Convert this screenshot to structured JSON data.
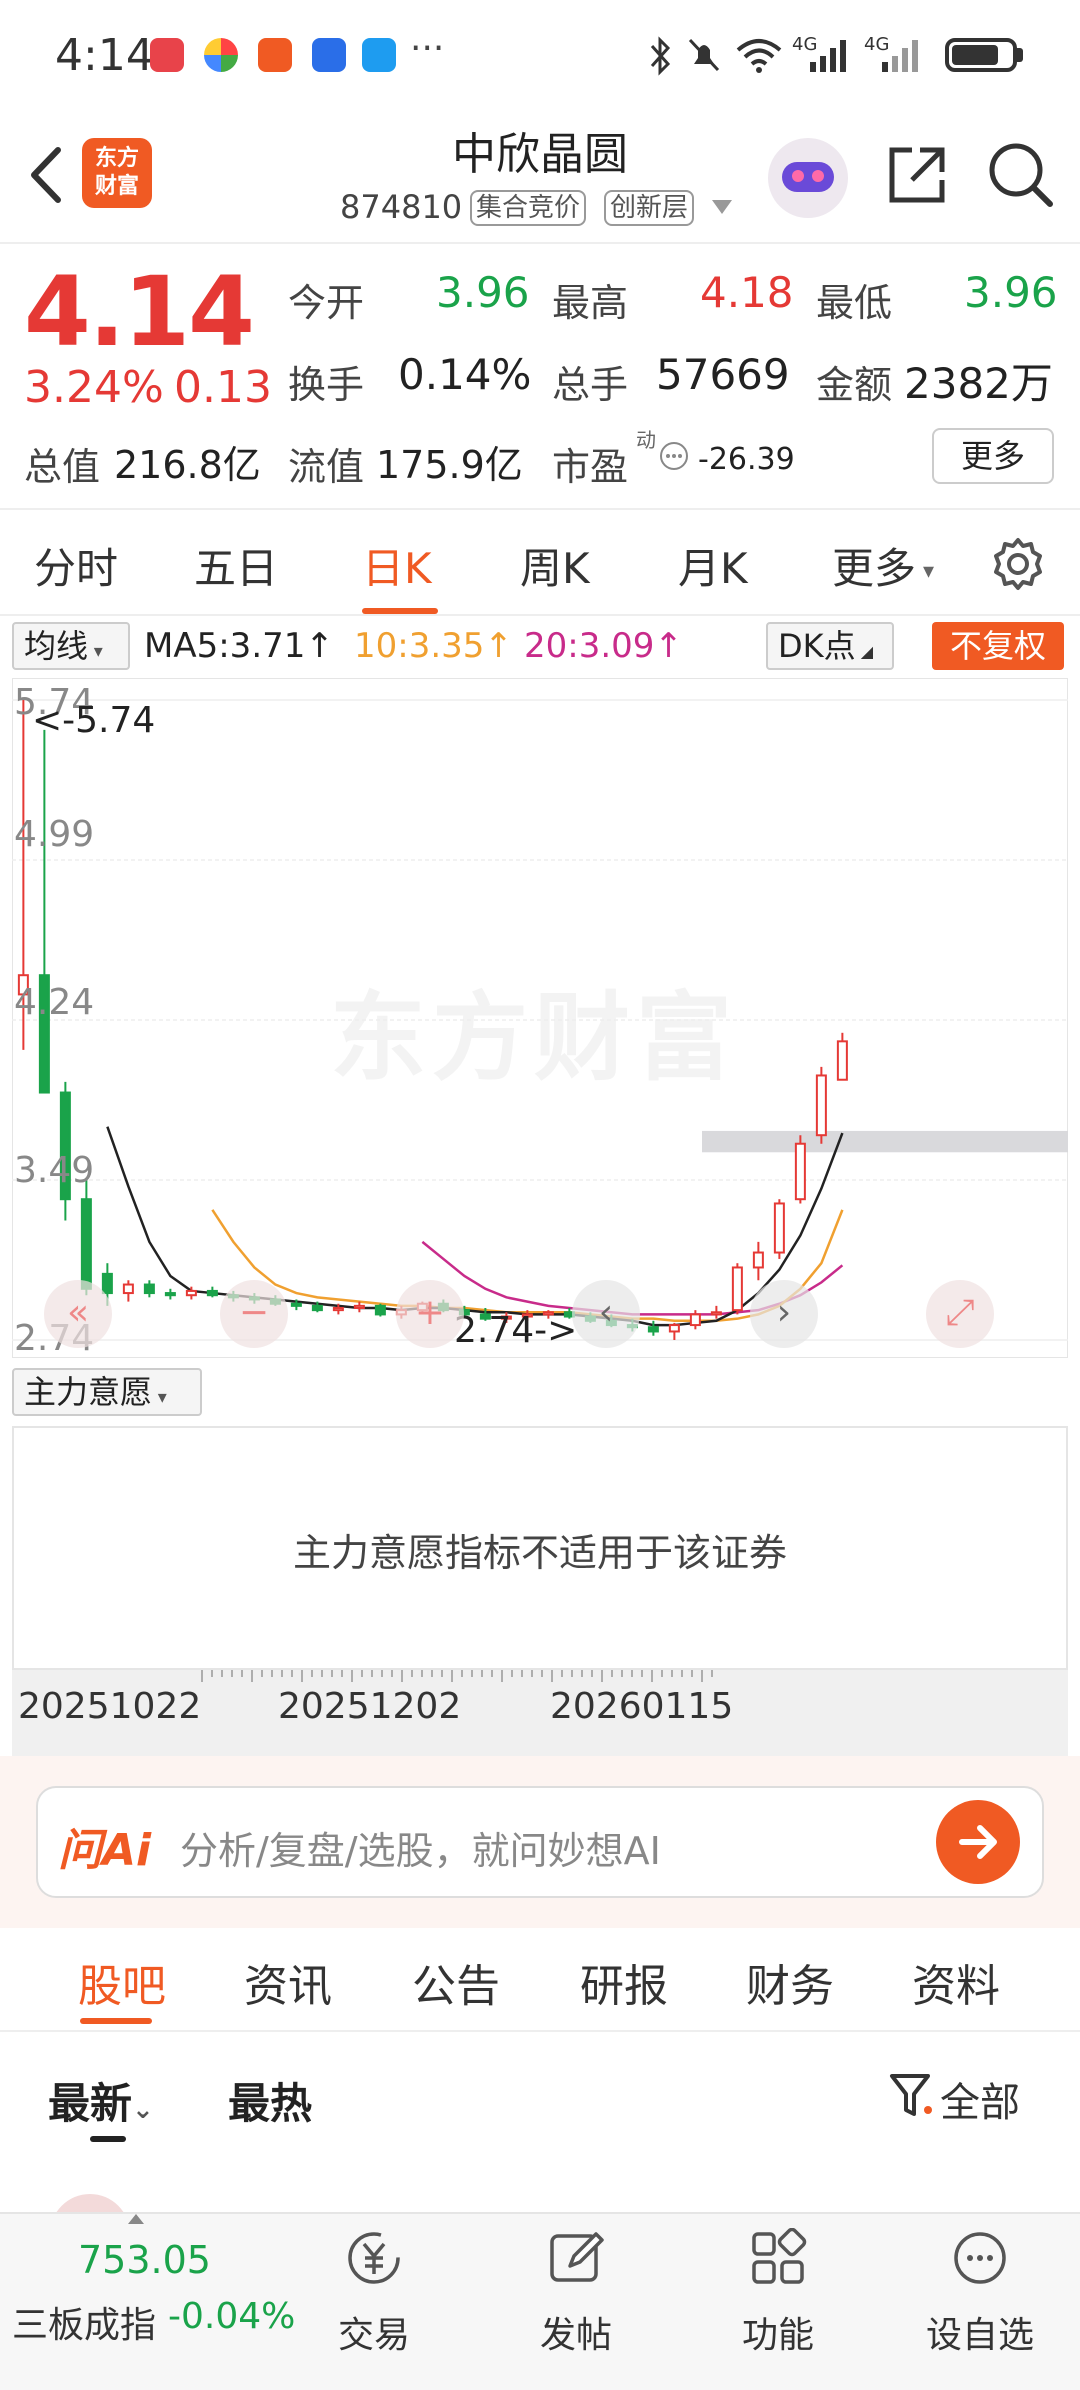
{
  "status_bar": {
    "time": "4:14",
    "more": "···",
    "signal1": "4G",
    "signal2": "4G"
  },
  "header": {
    "logo_text_line1": "东方",
    "logo_text_line2": "财富",
    "stock_name": "中欣晶圆",
    "code": "874810",
    "tag1": "集合竞价",
    "tag2": "创新层"
  },
  "quote": {
    "price": "4.14",
    "change_pct": "3.24%",
    "change": "0.13",
    "open_label": "今开",
    "open": "3.96",
    "high_label": "最高",
    "high": "4.18",
    "low_label": "最低",
    "low": "3.96",
    "turnover_label": "换手",
    "turnover": "0.14%",
    "volume_label": "总手",
    "volume": "57669",
    "amount_label": "金额",
    "amount": "2382万",
    "mktcap_label": "总值",
    "mktcap": "216.8亿",
    "float_label": "流值",
    "float": "175.9亿",
    "pe_label": "市盈",
    "pe_sup": "动",
    "pe": "-26.39",
    "more_button": "更多"
  },
  "period_tabs": [
    "分时",
    "五日",
    "日K",
    "周K",
    "月K",
    "更多"
  ],
  "active_period": "日K",
  "ma_legend": {
    "selector": "均线",
    "ma5": "MA5:3.71",
    "ma10": "10:3.35",
    "ma20": "20:3.09",
    "dk": "DK点",
    "adjust": "不复权"
  },
  "colors": {
    "accent": "#f05a23",
    "up": "#e53935",
    "down": "#1aa34a",
    "ma5": "#222222",
    "ma10": "#f0a030",
    "ma20": "#c82b8a"
  },
  "chart_data": {
    "type": "candlestick",
    "y_ticks": [
      "5.74",
      "4.99",
      "4.24",
      "3.49",
      "2.74"
    ],
    "ylim": [
      2.74,
      5.74
    ],
    "max_label": "<-5.74",
    "min_label": "2.74->",
    "watermark": "东方财富",
    "x_ticks": [
      "20251022",
      "20251202",
      "20260115"
    ],
    "candles": [
      {
        "o": 4.36,
        "h": 5.74,
        "l": 4.1,
        "c": 4.45
      },
      {
        "o": 4.45,
        "h": 5.6,
        "l": 3.9,
        "c": 3.9
      },
      {
        "o": 3.9,
        "h": 3.95,
        "l": 3.3,
        "c": 3.4
      },
      {
        "o": 3.4,
        "h": 3.5,
        "l": 2.95,
        "c": 2.98
      },
      {
        "o": 3.05,
        "h": 3.1,
        "l": 2.9,
        "c": 2.96
      },
      {
        "o": 2.96,
        "h": 3.02,
        "l": 2.92,
        "c": 3.0
      },
      {
        "o": 3.0,
        "h": 3.02,
        "l": 2.94,
        "c": 2.96
      },
      {
        "o": 2.96,
        "h": 2.98,
        "l": 2.93,
        "c": 2.95
      },
      {
        "o": 2.95,
        "h": 2.99,
        "l": 2.93,
        "c": 2.97
      },
      {
        "o": 2.97,
        "h": 2.99,
        "l": 2.94,
        "c": 2.95
      },
      {
        "o": 2.95,
        "h": 2.97,
        "l": 2.92,
        "c": 2.94
      },
      {
        "o": 2.94,
        "h": 2.96,
        "l": 2.91,
        "c": 2.93
      },
      {
        "o": 2.93,
        "h": 2.95,
        "l": 2.9,
        "c": 2.91
      },
      {
        "o": 2.91,
        "h": 2.93,
        "l": 2.88,
        "c": 2.9
      },
      {
        "o": 2.9,
        "h": 2.92,
        "l": 2.87,
        "c": 2.88
      },
      {
        "o": 2.88,
        "h": 2.91,
        "l": 2.86,
        "c": 2.89
      },
      {
        "o": 2.89,
        "h": 2.92,
        "l": 2.87,
        "c": 2.9
      },
      {
        "o": 2.9,
        "h": 2.91,
        "l": 2.85,
        "c": 2.86
      },
      {
        "o": 2.86,
        "h": 2.9,
        "l": 2.84,
        "c": 2.88
      },
      {
        "o": 2.88,
        "h": 2.92,
        "l": 2.86,
        "c": 2.91
      },
      {
        "o": 2.91,
        "h": 2.93,
        "l": 2.87,
        "c": 2.88
      },
      {
        "o": 2.88,
        "h": 2.9,
        "l": 2.85,
        "c": 2.86
      },
      {
        "o": 2.86,
        "h": 2.89,
        "l": 2.83,
        "c": 2.84
      },
      {
        "o": 2.84,
        "h": 2.87,
        "l": 2.82,
        "c": 2.85
      },
      {
        "o": 2.85,
        "h": 2.88,
        "l": 2.83,
        "c": 2.86
      },
      {
        "o": 2.86,
        "h": 2.88,
        "l": 2.84,
        "c": 2.87
      },
      {
        "o": 2.87,
        "h": 2.89,
        "l": 2.84,
        "c": 2.85
      },
      {
        "o": 2.85,
        "h": 2.87,
        "l": 2.82,
        "c": 2.83
      },
      {
        "o": 2.83,
        "h": 2.86,
        "l": 2.8,
        "c": 2.81
      },
      {
        "o": 2.81,
        "h": 2.84,
        "l": 2.78,
        "c": 2.8
      },
      {
        "o": 2.8,
        "h": 2.83,
        "l": 2.76,
        "c": 2.78
      },
      {
        "o": 2.78,
        "h": 2.82,
        "l": 2.74,
        "c": 2.81
      },
      {
        "o": 2.81,
        "h": 2.88,
        "l": 2.79,
        "c": 2.86
      },
      {
        "o": 2.86,
        "h": 2.9,
        "l": 2.84,
        "c": 2.87
      },
      {
        "o": 2.88,
        "h": 3.1,
        "l": 2.86,
        "c": 3.08
      },
      {
        "o": 3.08,
        "h": 3.2,
        "l": 3.02,
        "c": 3.15
      },
      {
        "o": 3.15,
        "h": 3.4,
        "l": 3.12,
        "c": 3.38
      },
      {
        "o": 3.4,
        "h": 3.7,
        "l": 3.38,
        "c": 3.66
      },
      {
        "o": 3.7,
        "h": 4.02,
        "l": 3.66,
        "c": 3.98
      },
      {
        "o": 3.96,
        "h": 4.18,
        "l": 3.96,
        "c": 4.14
      }
    ],
    "ma5": [
      null,
      null,
      null,
      null,
      3.74,
      3.46,
      3.2,
      3.04,
      2.97,
      2.96,
      2.95,
      2.94,
      2.93,
      2.92,
      2.91,
      2.9,
      2.89,
      2.89,
      2.88,
      2.89,
      2.89,
      2.88,
      2.87,
      2.87,
      2.86,
      2.86,
      2.86,
      2.85,
      2.84,
      2.83,
      2.81,
      2.81,
      2.82,
      2.83,
      2.88,
      2.96,
      3.07,
      3.23,
      3.45,
      3.71
    ],
    "ma10": [
      null,
      null,
      null,
      null,
      null,
      null,
      null,
      null,
      null,
      3.35,
      3.2,
      3.08,
      3.0,
      2.96,
      2.94,
      2.93,
      2.92,
      2.91,
      2.9,
      2.9,
      2.89,
      2.89,
      2.88,
      2.87,
      2.87,
      2.87,
      2.87,
      2.86,
      2.85,
      2.84,
      2.84,
      2.83,
      2.83,
      2.83,
      2.84,
      2.86,
      2.9,
      2.98,
      3.1,
      3.35
    ],
    "ma20": [
      null,
      null,
      null,
      null,
      null,
      null,
      null,
      null,
      null,
      null,
      null,
      null,
      null,
      null,
      null,
      null,
      null,
      null,
      null,
      3.2,
      3.12,
      3.04,
      2.98,
      2.94,
      2.92,
      2.9,
      2.89,
      2.88,
      2.87,
      2.86,
      2.86,
      2.86,
      2.86,
      2.86,
      2.87,
      2.88,
      2.91,
      2.95,
      3.01,
      3.09
    ],
    "resistance_band": {
      "from": 3.62,
      "to": 3.72
    }
  },
  "indicator": {
    "selector": "主力意愿",
    "message": "主力意愿指标不适用于该证券"
  },
  "ai": {
    "logo": "问Ai",
    "placeholder": "分析/复盘/选股，就问妙想AI"
  },
  "info_tabs": [
    "股吧",
    "资讯",
    "公告",
    "研报",
    "财务",
    "资料"
  ],
  "sort": {
    "latest": "最新",
    "hot": "最热",
    "filter": "全部"
  },
  "bottom": {
    "index_value": "753.05",
    "index_name": "三板成指",
    "index_change": "-0.04%",
    "nav": [
      "交易",
      "发帖",
      "功能",
      "设自选"
    ]
  }
}
